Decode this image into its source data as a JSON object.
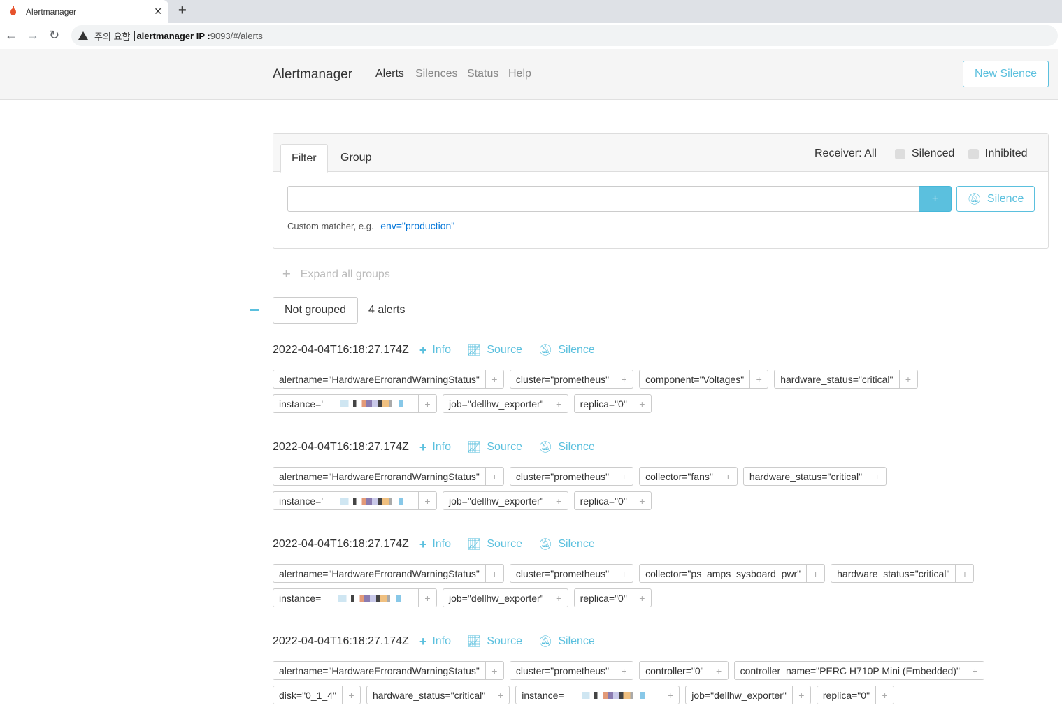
{
  "browser": {
    "tab_title": "Alertmanager",
    "tab_close": "✕",
    "new_tab": "+",
    "back": "←",
    "forward": "→",
    "reload": "↻",
    "url_warning": "주의 요함",
    "url_host": "alertmanager IP :",
    "url_path": "9093/#/alerts"
  },
  "navbar": {
    "brand": "Alertmanager",
    "links": [
      "Alerts",
      "Silences",
      "Status",
      "Help"
    ],
    "new_silence": "New Silence"
  },
  "filter": {
    "tabs": [
      "Filter",
      "Group"
    ],
    "receiver": "Receiver: All",
    "silenced": "Silenced",
    "inhibited": "Inhibited",
    "input_value": "",
    "plus": "+",
    "silence_btn": "Silence",
    "hint": "Custom matcher, e.g.",
    "hint_example": "env=\"production\""
  },
  "groups": {
    "expand_all": "Expand all groups",
    "group_label": "Not grouped",
    "alert_count": "4 alerts"
  },
  "actions": {
    "info": "Info",
    "source": "Source",
    "silence": "Silence"
  },
  "alerts": [
    {
      "timestamp": "2022-04-04T16:18:27.174Z",
      "labels": [
        "alertname=\"HardwareErrorandWarningStatus\"",
        "cluster=\"prometheus\"",
        "component=\"Voltages\"",
        "hardware_status=\"critical\"",
        "instance='",
        "job=\"dellhw_exporter\"",
        "replica=\"0\""
      ]
    },
    {
      "timestamp": "2022-04-04T16:18:27.174Z",
      "labels": [
        "alertname=\"HardwareErrorandWarningStatus\"",
        "cluster=\"prometheus\"",
        "collector=\"fans\"",
        "hardware_status=\"critical\"",
        "instance='",
        "job=\"dellhw_exporter\"",
        "replica=\"0\""
      ]
    },
    {
      "timestamp": "2022-04-04T16:18:27.174Z",
      "labels": [
        "alertname=\"HardwareErrorandWarningStatus\"",
        "cluster=\"prometheus\"",
        "collector=\"ps_amps_sysboard_pwr\"",
        "hardware_status=\"critical\"",
        "instance=",
        "job=\"dellhw_exporter\"",
        "replica=\"0\""
      ]
    },
    {
      "timestamp": "2022-04-04T16:18:27.174Z",
      "labels": [
        "alertname=\"HardwareErrorandWarningStatus\"",
        "cluster=\"prometheus\"",
        "controller=\"0\"",
        "controller_name=\"PERC H710P Mini (Embedded)\"",
        "disk=\"0_1_4\"",
        "hardware_status=\"critical\"",
        "instance=",
        "job=\"dellhw_exporter\"",
        "replica=\"0\""
      ]
    }
  ]
}
